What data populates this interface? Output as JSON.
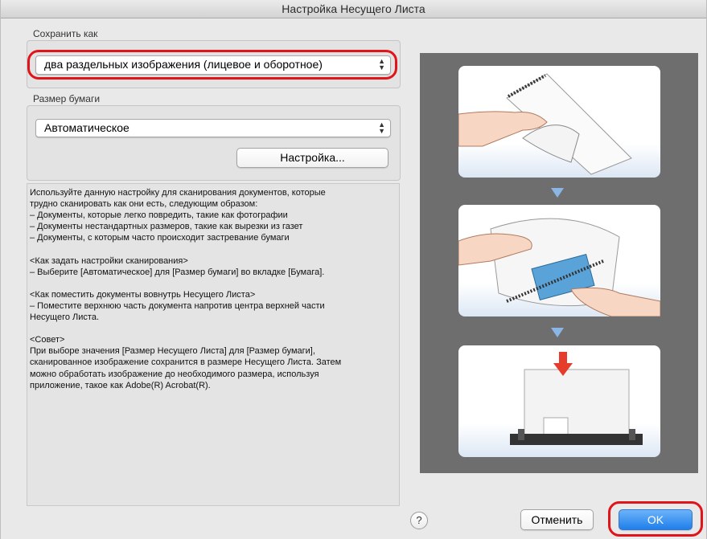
{
  "window": {
    "title": "Настройка Несущего Листа"
  },
  "save_as": {
    "label": "Сохранить как",
    "selected": "два раздельных изображения (лицевое и оборотное)"
  },
  "paper_size": {
    "label": "Размер бумаги",
    "selected": "Автоматическое",
    "settings_button": "Настройка..."
  },
  "description": {
    "text": "Используйте данную настройку для сканирования документов, которые\nтрудно сканировать как они есть, следующим образом:\n– Документы, которые легко повредить, такие как фотографии\n– Документы нестандартных размеров, такие как вырезки из газет\n– Документы, с которым часто происходит застревание бумаги\n\n<Как задать настройки сканирования>\n– Выберите [Автоматическое] для [Размер бумаги] во вкладке [Бумага].\n\n<Как поместить документы вовнутрь Несущего Листа>\n– Поместите верхнюю часть документа напротив центра верхней части\nНесущего Листа.\n\n<Совет>\nПри выборе значения [Размер Несущего Листа] для [Размер бумаги],\nсканированное изображение сохранится в размере Несущего Листа. Затем\nможно обработать изображение до необходимого размера, используя\nприложение, такое как Adobe(R) Acrobat(R)."
  },
  "footer": {
    "help": "?",
    "cancel": "Отменить",
    "ok": "OK"
  },
  "colors": {
    "highlight_ring": "#e1141a",
    "default_button": "#1f7fea",
    "illustration_bg": "#6e6e6e",
    "step_arrow": "#8ab6e6"
  }
}
